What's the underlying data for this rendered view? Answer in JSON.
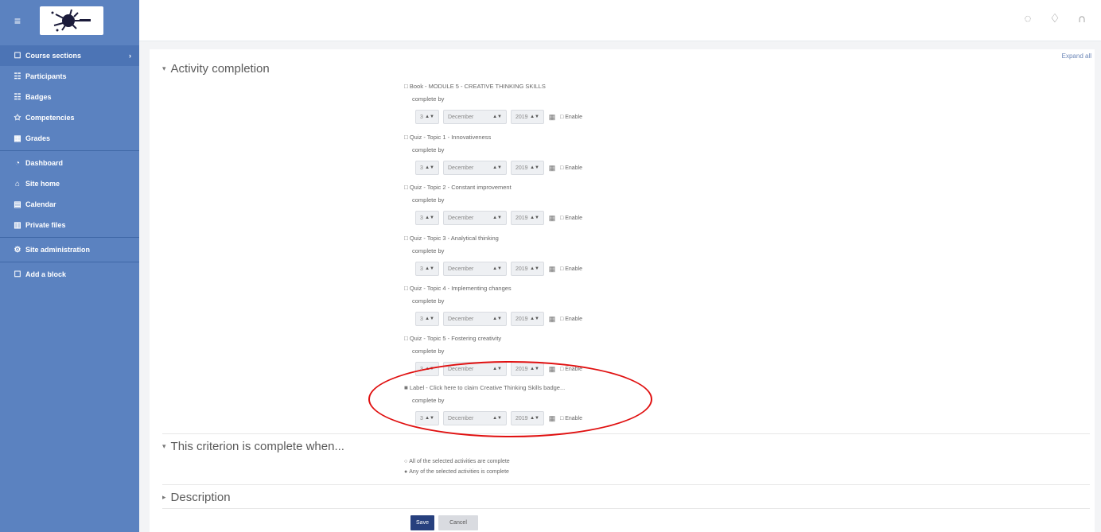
{
  "navbar": {
    "menu_icon": "hamburger-icon",
    "icons": [
      "chat-icon",
      "bell-icon",
      "user-avatar-icon"
    ]
  },
  "sidebar": {
    "items": [
      {
        "icon": "folder-icon",
        "glyph": "☐",
        "label": "Course sections",
        "chevron": "›"
      },
      {
        "icon": "users-icon",
        "glyph": "☷",
        "label": "Participants"
      },
      {
        "icon": "badge-icon",
        "glyph": "☷",
        "label": "Badges"
      },
      {
        "icon": "competencies-icon",
        "glyph": "✩",
        "label": "Competencies"
      },
      {
        "icon": "grades-icon",
        "glyph": "▦",
        "label": "Grades"
      },
      {
        "icon": "dashboard-icon",
        "glyph": "◔",
        "label": "Dashboard"
      },
      {
        "icon": "home-icon",
        "glyph": "⌂",
        "label": "Site home"
      },
      {
        "icon": "calendar-icon",
        "glyph": "▤",
        "label": "Calendar"
      },
      {
        "icon": "files-icon",
        "glyph": "▥",
        "label": "Private files"
      },
      {
        "icon": "settings-icon",
        "glyph": "⚙",
        "label": "Site administration"
      },
      {
        "icon": "add-block-icon",
        "glyph": "☐",
        "label": "Add a block"
      }
    ]
  },
  "main": {
    "expand_all": "Expand all",
    "section_activity": "Activity completion",
    "section_criterion": "This criterion is complete when...",
    "section_description": "Description",
    "complete_by_label": "complete by",
    "enable_label": "Enable",
    "activities": [
      {
        "title": "Book - MODULE 5 - CREATIVE THINKING SKILLS",
        "checked": false,
        "day": "3",
        "month": "December",
        "year": "2019"
      },
      {
        "title": "Quiz - Topic 1 - Innovativeness",
        "checked": false,
        "day": "3",
        "month": "December",
        "year": "2019"
      },
      {
        "title": "Quiz - Topic 2 - Constant improvement",
        "checked": false,
        "day": "3",
        "month": "December",
        "year": "2019"
      },
      {
        "title": "Quiz - Topic 3 - Analytical thinking",
        "checked": false,
        "day": "3",
        "month": "December",
        "year": "2019"
      },
      {
        "title": "Quiz - Topic 4 - Implementing changes",
        "checked": false,
        "day": "3",
        "month": "December",
        "year": "2019"
      },
      {
        "title": "Quiz - Topic 5 - Fostering creativity",
        "checked": false,
        "day": "3",
        "month": "December",
        "year": "2019"
      },
      {
        "title": "Label - Click here to claim Creative Thinking Skills badge...",
        "checked": true,
        "day": "3",
        "month": "December",
        "year": "2019"
      }
    ],
    "criterion_options": [
      {
        "label": "All of the selected activities are complete",
        "selected": false
      },
      {
        "label": "Any of the selected activities is complete",
        "selected": true
      }
    ]
  },
  "buttons": {
    "save": "Save",
    "cancel": "Cancel"
  },
  "colors": {
    "sidebar_bg": "#5b82c0",
    "primary_button": "#27407e",
    "annotation": "#e01010"
  }
}
